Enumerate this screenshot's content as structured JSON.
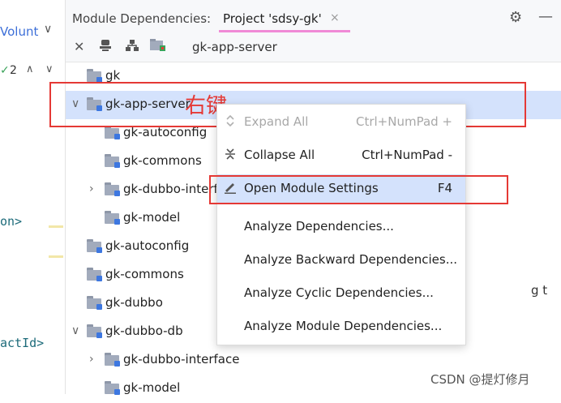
{
  "left_strip": {
    "volunt": "Volunt",
    "chevron": "∨",
    "check": "✓",
    "count": "2",
    "up": "∧",
    "down": "∨",
    "code1": "on>",
    "code2": "actId>"
  },
  "header": {
    "title": "Module Dependencies:",
    "tab": "Project 'sdsy-gk'",
    "tab_close": "×",
    "gear": "⚙",
    "minimize": "—"
  },
  "toolbar": {
    "close": "✕",
    "path": "gk-app-server"
  },
  "tree": [
    {
      "label": "gk"
    },
    {
      "label": "gk-app-server",
      "arrow": "∨"
    },
    {
      "label": "gk-autoconfig"
    },
    {
      "label": "gk-commons"
    },
    {
      "label": "gk-dubbo-interface",
      "arrow": "›"
    },
    {
      "label": "gk-model"
    },
    {
      "label": "gk-autoconfig"
    },
    {
      "label": "gk-commons"
    },
    {
      "label": "gk-dubbo"
    },
    {
      "label": "gk-dubbo-db",
      "arrow": "∨"
    },
    {
      "label": "gk-dubbo-interface",
      "arrow": "›"
    },
    {
      "label": "gk-model"
    }
  ],
  "annotation": {
    "text": "右键",
    "color": "#e53935"
  },
  "context_menu": {
    "items": [
      {
        "label": "Expand All",
        "shortcut": "Ctrl+NumPad +"
      },
      {
        "label": "Collapse All",
        "shortcut": "Ctrl+NumPad -"
      },
      {
        "label": "Open Module Settings",
        "shortcut": "F4"
      },
      {
        "label": "Analyze Dependencies..."
      },
      {
        "label": "Analyze Backward Dependencies..."
      },
      {
        "label": "Analyze Cyclic Dependencies..."
      },
      {
        "label": "Analyze Module Dependencies..."
      }
    ]
  },
  "right_fragment": "g t",
  "watermark": "CSDN @提灯修月",
  "colors": {
    "selection": "#d4e2fc",
    "accent_underline": "#f08ad6",
    "annotation": "#e53935",
    "folder": "#a2abbc",
    "module_mark": "#3d77e0"
  }
}
